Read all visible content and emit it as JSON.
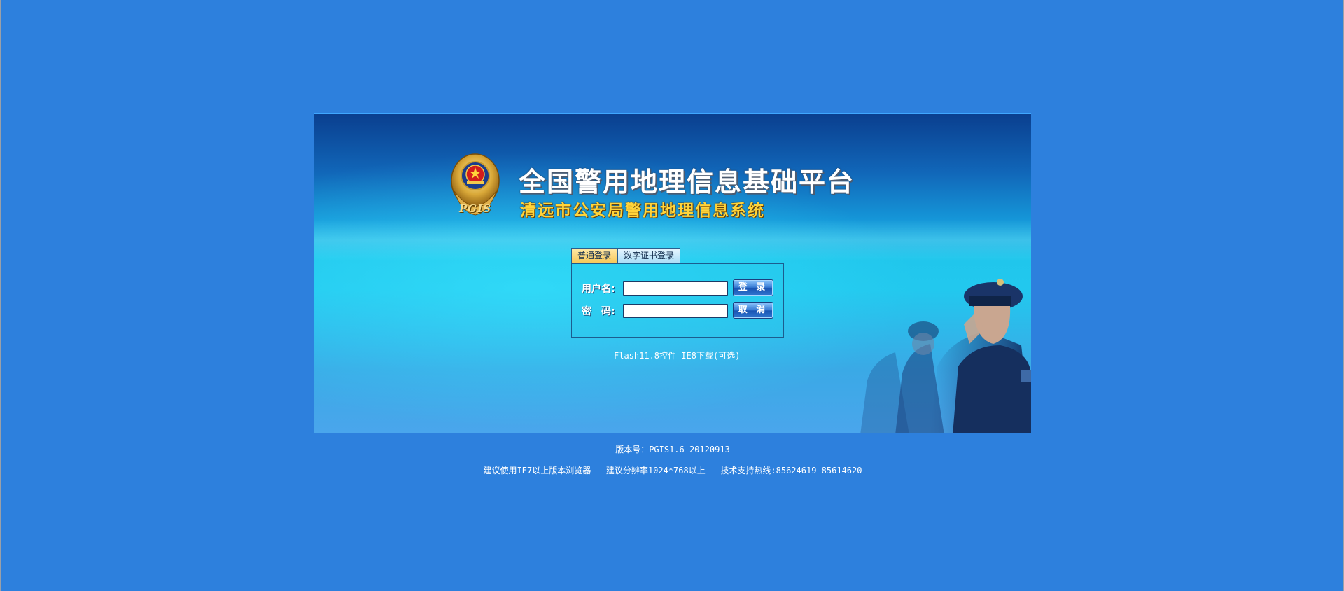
{
  "header": {
    "title_main": "全国警用地理信息基础平台",
    "title_sub": "清远市公安局警用地理信息系统",
    "emblem_text": "PGIS"
  },
  "tabs": [
    {
      "label": "普通登录",
      "active": true
    },
    {
      "label": "数字证书登录",
      "active": false
    }
  ],
  "login": {
    "username_label": "用户名:",
    "password_label": "密　码:",
    "username_value": "",
    "password_value": "",
    "login_button": "登 录",
    "cancel_button": "取 消"
  },
  "downloads": {
    "flash_link": "Flash11.8控件",
    "ie8_link": "IE8下载(可选)"
  },
  "footer": {
    "version": "版本号：PGIS1.6  20120913",
    "browser_hint": "建议使用IE7以上版本浏览器",
    "resolution_hint": "建议分辨率1024*768以上",
    "support_hotline": "技术支持热线:85624619 85614620"
  },
  "colors": {
    "page_bg": "#2d80dd",
    "title_sub": "#ffd43a",
    "tab_active": "#f6c653",
    "tab_inactive": "#a6dcf7",
    "button": "#2f75d0"
  },
  "icons": {
    "emblem": "police-emblem-icon"
  }
}
